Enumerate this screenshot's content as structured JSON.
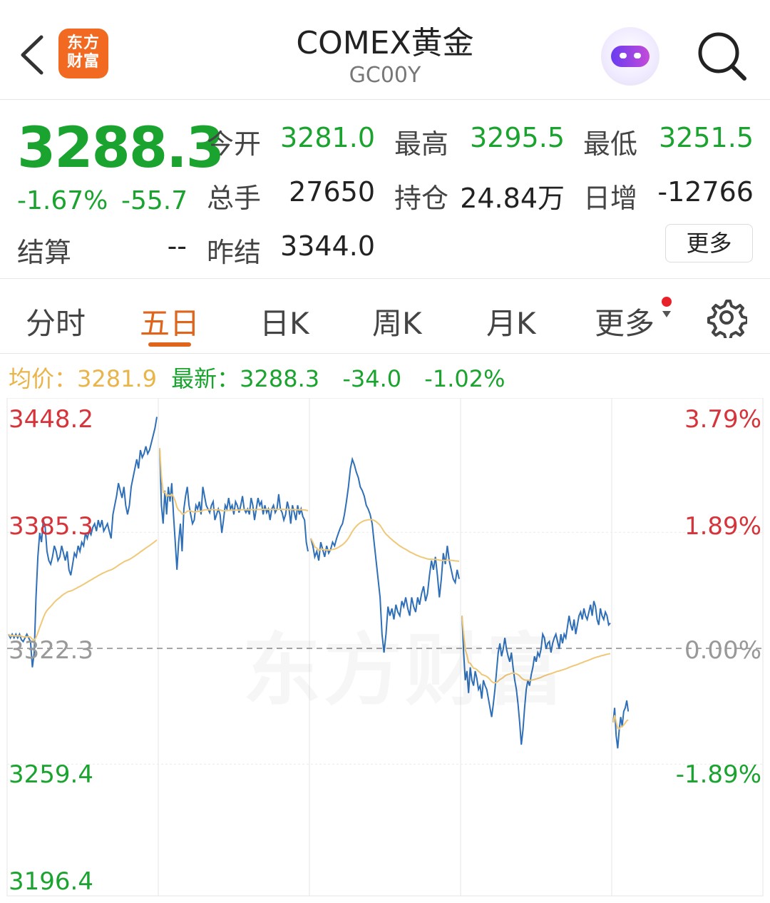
{
  "header": {
    "title": "COMEX黄金",
    "code": "GC00Y",
    "logo_text": [
      "东方",
      "财富"
    ]
  },
  "quote": {
    "price": "3288.3",
    "change_pct": "-1.67%",
    "change_value": "-55.7",
    "fields": [
      {
        "label": "今开",
        "value": "3281.0"
      },
      {
        "label": "最高",
        "value": "3295.5"
      },
      {
        "label": "最低",
        "value": "3251.5"
      },
      {
        "label": "总手",
        "value": "27650"
      },
      {
        "label": "持仓",
        "value": "24.84万"
      },
      {
        "label": "日增",
        "value": "-12766"
      },
      {
        "label": "结算",
        "value": "--"
      },
      {
        "label": "昨结",
        "value": "3344.0"
      }
    ],
    "more_label": "更多"
  },
  "tabs": [
    {
      "label": "分时"
    },
    {
      "label": "五日",
      "active": true
    },
    {
      "label": "日K"
    },
    {
      "label": "周K"
    },
    {
      "label": "月K"
    },
    {
      "label": "更多"
    }
  ],
  "info": {
    "avg_label": "均价：",
    "avg_value": "3281.9",
    "latest_label": "最新：",
    "latest_value": "3288.3",
    "change": "-34.0",
    "change_pct": "-1.02%"
  },
  "colors": {
    "up": "#d6343a",
    "down": "#1aa32e",
    "price_line": "#2f6fb8",
    "avg_line": "#efc878",
    "accent": "#e0651c"
  },
  "chart_data": {
    "type": "line",
    "y_labels_left": [
      "3448.2",
      "3385.3",
      "3322.3",
      "3259.4",
      "3196.4"
    ],
    "y_labels_right": [
      "3.79%",
      "1.89%",
      "0.00%",
      "-1.89%",
      ""
    ],
    "ylim": [
      3196.4,
      3448.2
    ],
    "baseline": 3322.3,
    "days": 5,
    "series": [
      {
        "values": [
          [
            3330,
            3328,
            3330,
            3328,
            3330,
            3328,
            3330,
            3327,
            3326,
            3328,
            3330,
            3328,
            3326,
            3312,
            3320,
            3350,
            3372,
            3385,
            3380,
            3392,
            3388,
            3375,
            3370,
            3368,
            3372,
            3378,
            3375,
            3370,
            3372,
            3378,
            3374,
            3370,
            3375,
            3365,
            3362,
            3368,
            3374,
            3372,
            3378,
            3375,
            3380,
            3378,
            3385,
            3382,
            3386,
            3384,
            3388,
            3390,
            3386,
            3392,
            3388,
            3392,
            3386,
            3388,
            3390,
            3386,
            3382,
            3395,
            3400,
            3405,
            3412,
            3408,
            3404,
            3410,
            3400,
            3395,
            3400,
            3410,
            3415,
            3420,
            3425,
            3420,
            3430,
            3426,
            3428,
            3432,
            3428,
            3430,
            3434,
            3438,
            3442,
            3448
          ],
          [
            3431,
            3400,
            3390,
            3408,
            3395,
            3410,
            3402,
            3412,
            3395,
            3380,
            3365,
            3380,
            3390,
            3375,
            3398,
            3405,
            3410,
            3400,
            3395,
            3390,
            3392,
            3400,
            3398,
            3402,
            3395,
            3410,
            3405,
            3400,
            3398,
            3396,
            3400,
            3402,
            3392,
            3395,
            3398,
            3395,
            3385,
            3392,
            3400,
            3398,
            3404,
            3398,
            3400,
            3395,
            3402,
            3400,
            3396,
            3400,
            3405,
            3398,
            3396,
            3398,
            3395,
            3404,
            3400,
            3392,
            3398,
            3404,
            3400,
            3402,
            3395,
            3400,
            3396,
            3398,
            3392,
            3398,
            3400,
            3396,
            3398,
            3406,
            3398,
            3396,
            3392,
            3395,
            3402,
            3398,
            3390,
            3400,
            3396,
            3392,
            3400,
            3395,
            3398,
            3394,
            3392,
            3380,
            3375
          ],
          [
            3382,
            3378,
            3372,
            3375,
            3370,
            3380,
            3376,
            3372,
            3378,
            3374,
            3376,
            3380,
            3378,
            3382,
            3385,
            3388,
            3390,
            3395,
            3402,
            3410,
            3420,
            3425,
            3422,
            3418,
            3415,
            3410,
            3408,
            3405,
            3400,
            3398,
            3395,
            3390,
            3380,
            3370,
            3360,
            3350,
            3330,
            3320,
            3330,
            3345,
            3340,
            3344,
            3338,
            3346,
            3342,
            3340,
            3348,
            3345,
            3350,
            3344,
            3340,
            3350,
            3345,
            3342,
            3350,
            3346,
            3352,
            3356,
            3348,
            3352,
            3362,
            3370,
            3365,
            3372,
            3362,
            3350,
            3360,
            3374,
            3368,
            3378,
            3370,
            3365,
            3360,
            3358,
            3365,
            3360
          ],
          [
            3340,
            3320,
            3305,
            3310,
            3298,
            3312,
            3305,
            3302,
            3310,
            3306,
            3300,
            3302,
            3295,
            3305,
            3302,
            3300,
            3295,
            3290,
            3285,
            3292,
            3300,
            3310,
            3320,
            3325,
            3318,
            3322,
            3328,
            3322,
            3318,
            3315,
            3320,
            3312,
            3305,
            3300,
            3292,
            3282,
            3270,
            3278,
            3290,
            3300,
            3305,
            3302,
            3308,
            3312,
            3318,
            3315,
            3320,
            3318,
            3322,
            3330,
            3328,
            3322,
            3325,
            3326,
            3320,
            3325,
            3328,
            3330,
            3326,
            3322,
            3330,
            3325,
            3330,
            3328,
            3334,
            3340,
            3335,
            3332,
            3338,
            3330,
            3335,
            3340,
            3342,
            3338,
            3344,
            3340,
            3338,
            3342,
            3346,
            3340,
            3348,
            3345,
            3338,
            3335,
            3344,
            3340,
            3338,
            3342,
            3340,
            3335,
            3336
          ],
          [
            3282,
            3290,
            3275,
            3268,
            3278,
            3285,
            3280,
            3288,
            3290,
            3294,
            3288
          ]
        ]
      }
    ]
  }
}
